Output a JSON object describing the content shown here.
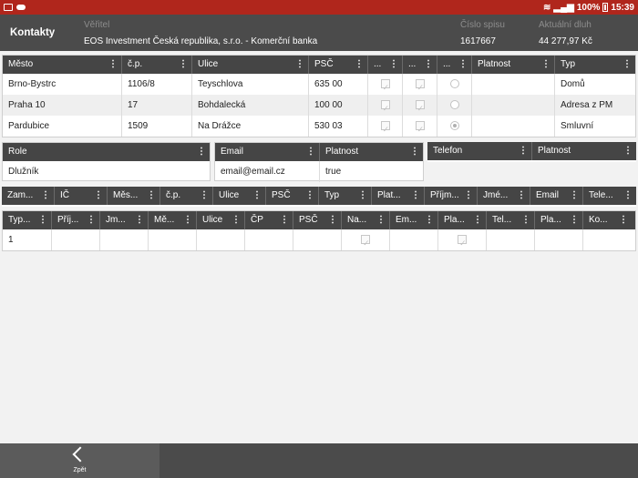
{
  "statusbar": {
    "battery": "100%",
    "time": "15:39",
    "icons": [
      "image-icon",
      "cloud-icon",
      "wifi-icon",
      "signal-icon",
      "battery-icon"
    ]
  },
  "header": {
    "title": "Kontakty",
    "veritel_label": "Věřitel",
    "veritel_value": "EOS Investment Česká republika, s.r.o. - Komerční banka",
    "spis_label": "Číslo spisu",
    "spis_value": "1617667",
    "dluh_label": "Aktuální dluh",
    "dluh_value": "44 277,97 Kč"
  },
  "addresses": {
    "columns": [
      "Město",
      "č.p.",
      "Ulice",
      "PSČ",
      "...",
      "...",
      "...",
      "Platnost",
      "Typ"
    ],
    "rows": [
      {
        "mesto": "Brno-Bystrc",
        "cp": "1106/8",
        "ulice": "Teyschlova",
        "psc": "635 00",
        "c1": true,
        "c2": true,
        "r": false,
        "platnost": "",
        "typ": "Domů"
      },
      {
        "mesto": "Praha 10",
        "cp": "17",
        "ulice": "Bohdalecká",
        "psc": "100 00",
        "c1": true,
        "c2": true,
        "r": false,
        "platnost": "",
        "typ": "Adresa z PM"
      },
      {
        "mesto": "Pardubice",
        "cp": "1509",
        "ulice": "Na Drážce",
        "psc": "530 03",
        "c1": true,
        "c2": true,
        "r": true,
        "platnost": "",
        "typ": "Smluvní"
      }
    ]
  },
  "role": {
    "header": "Role",
    "value": "Dlužník"
  },
  "email": {
    "columns": [
      "Email",
      "Platnost"
    ],
    "email": "email@email.cz",
    "platnost": "true"
  },
  "telefon": {
    "columns": [
      "Telefon",
      "Platnost"
    ]
  },
  "employer": {
    "columns": [
      "Zam...",
      "IČ",
      "Měs...",
      "č.p.",
      "Ulice",
      "PSČ",
      "Typ",
      "Plat...",
      "Příjm...",
      "Jmé...",
      "Email",
      "Tele..."
    ]
  },
  "persons": {
    "columns": [
      "Typ...",
      "Příj...",
      "Jm...",
      "Mě...",
      "Ulice",
      "ČP",
      "PSČ",
      "Na...",
      "Em...",
      "Pla...",
      "Tel...",
      "Pla...",
      "Ko..."
    ],
    "rows": [
      {
        "typ": "1"
      }
    ]
  },
  "footer": {
    "back_label": "Zpět"
  }
}
